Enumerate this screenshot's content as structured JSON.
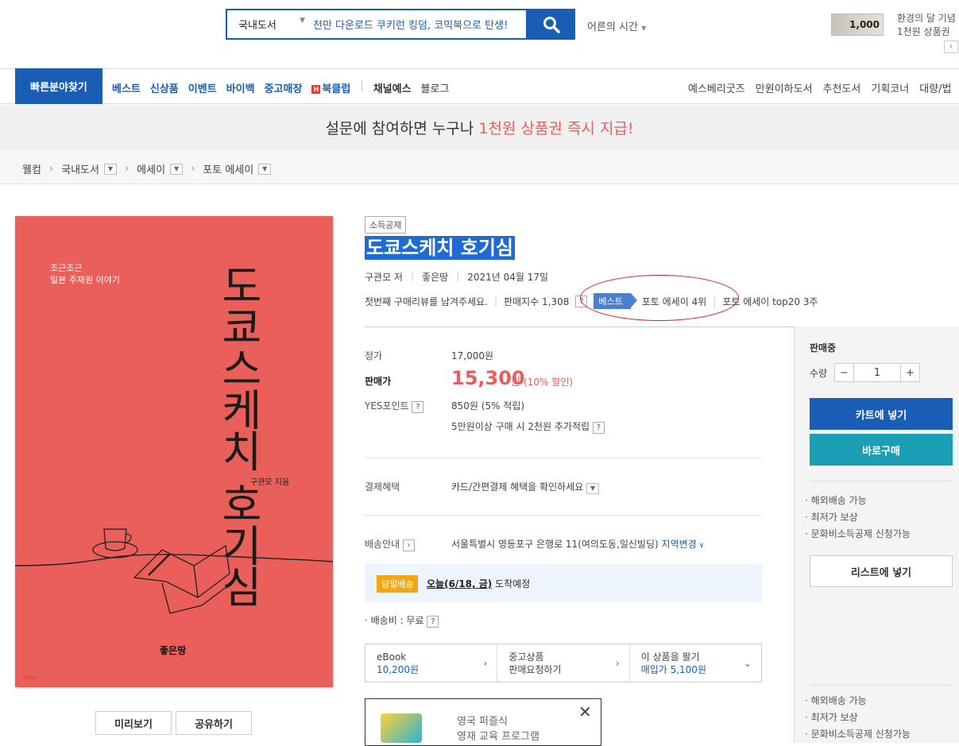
{
  "header": {
    "search_category": "국내도서",
    "search_placeholder": "천만 다운로드 쿠키런 킹덤, 코믹북으로 탄생!",
    "adult_time": "어른의 시간",
    "voucher_amount": "1,000",
    "promo_line1": "환경의 달 기념",
    "promo_line2": "1천원 상품권"
  },
  "nav": {
    "quick_category": "빠른분야찾기",
    "main": [
      "베스트",
      "신상품",
      "이벤트",
      "바이백",
      "중고매장",
      "북클럽"
    ],
    "channel": "채널예스",
    "blog": "블로그",
    "right": [
      "예스베리굿즈",
      "만원이하도서",
      "추천도서",
      "기획코너",
      "대량/법"
    ]
  },
  "banner": {
    "text": "설문에 참여하면 누구나 ",
    "highlight": "1천원 상품권 즉시 지급!"
  },
  "breadcrumb": [
    "웰컴",
    "국내도서",
    "에세이",
    "포토 에세이"
  ],
  "cover": {
    "subtitle1": "조근조근",
    "subtitle2": "일본 주재원 이야기",
    "title": "도쿄스케치 호기심",
    "author": "구관모 지음",
    "publisher": "좋은땅",
    "code": "YES24",
    "preview_button": "미리보기",
    "share_button": "공유하기"
  },
  "book": {
    "tax_badge": "소득공제",
    "title": "도쿄스케치 호기심",
    "author": "구관모 저",
    "publisher": "좋은땅",
    "pub_date": "2021년 04월 17일",
    "review_prompt": "첫번째 구매리뷰를 남겨주세요.",
    "sales_index": "판매지수 1,308",
    "best_tag": "베스트",
    "best_rank": "포토 에세이 4위",
    "top20": "포토 에세이 top20 3주"
  },
  "price": {
    "list_label": "정가",
    "list_price": "17,000원",
    "sale_label": "판매가",
    "sale_price": "15,300",
    "sale_unit": "원",
    "discount": "(10% 할인)",
    "point_label": "YES포인트",
    "point_value": "850원 (5% 적립)",
    "point_extra": "5만원이상 구매 시 2천원 추가적립",
    "payment_label": "결제혜택",
    "payment_value": "카드/간편결제 혜택을 확인하세요",
    "shipping_label": "배송안내",
    "shipping_address": "서울특별시 영등포구 은행로 11(여의도동,일신빌딩)",
    "region_change": "지역변경",
    "today_badge": "당일배송",
    "today_date": "오늘(6/18, 금)",
    "today_suffix": " 도착예정",
    "shipping_fee": "배송비 : 무료"
  },
  "extras": [
    {
      "title": "eBook",
      "sub": "10,200원"
    },
    {
      "title": "중고상품",
      "sub": "판매요청하기"
    },
    {
      "title": "이 상품을 팔기",
      "sub": "매입가 5,100원"
    }
  ],
  "ad": {
    "line1": "영국 퍼즐식",
    "line2": "영재 교육 프로그램"
  },
  "purchase_panel": {
    "status": "판매중",
    "qty_label": "수량",
    "qty_value": "1",
    "cart_button": "카트에 넣기",
    "buy_button": "바로구매",
    "benefit1": "해외배송 가능",
    "benefit2": "최저가 보상",
    "benefit3": "문화비소득공제 신청가능",
    "list_button": "리스트에 넣기"
  }
}
